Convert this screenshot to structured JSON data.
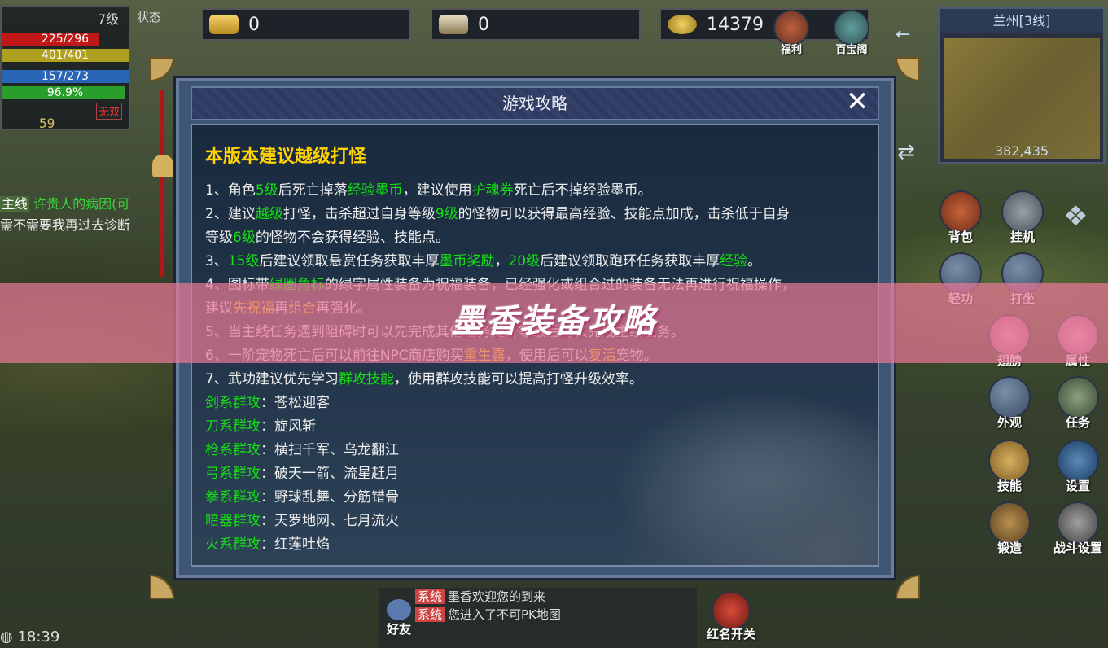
{
  "player": {
    "level": "7级",
    "state": "状态",
    "hp": "225/296",
    "mp": "401/401",
    "exp": "157/273",
    "percent": "96.9%",
    "tag": "无双",
    "value": "59",
    "hp_fraction": 0.76
  },
  "quest": {
    "tag": "主线",
    "title": "许贵人的病因(可",
    "text": "需不需要我再过去诊断"
  },
  "currencies": [
    {
      "name": "gold-ingot",
      "value": "0"
    },
    {
      "name": "locked-ingot",
      "value": "0"
    },
    {
      "name": "coins",
      "value": "14379"
    }
  ],
  "top_buttons": [
    "福利",
    "百宝阁"
  ],
  "minimap": {
    "title": "兰州[3线]",
    "coord": "382,435"
  },
  "side_buttons": [
    "背包",
    "挂机",
    "轻功",
    "打坐",
    "翅膀",
    "属性",
    "外观",
    "任务",
    "技能",
    "设置",
    "锻造",
    "战斗设置"
  ],
  "dialog": {
    "title": "游戏攻略",
    "heading": "本版本建议越级打怪",
    "lines": [
      [
        {
          "t": "1、角色"
        },
        {
          "t": "5级",
          "c": "g"
        },
        {
          "t": "后死亡掉落"
        },
        {
          "t": "经验墨币",
          "c": "g"
        },
        {
          "t": "，建议使用"
        },
        {
          "t": "护魂券",
          "c": "g"
        },
        {
          "t": "死亡后不掉经验墨币。"
        }
      ],
      [
        {
          "t": "2、建议"
        },
        {
          "t": "越级",
          "c": "g"
        },
        {
          "t": "打怪，击杀超过自身等级"
        },
        {
          "t": "9级",
          "c": "g"
        },
        {
          "t": "的怪物可以获得最高经验、技能点加成，击杀低于自身"
        }
      ],
      [
        {
          "t": "等级"
        },
        {
          "t": "6级",
          "c": "g"
        },
        {
          "t": "的怪物不会获得经验、技能点。"
        }
      ],
      [
        {
          "t": "3、"
        },
        {
          "t": "15级",
          "c": "g"
        },
        {
          "t": "后建议领取悬赏任务获取丰厚"
        },
        {
          "t": "墨币奖励",
          "c": "g"
        },
        {
          "t": "，"
        },
        {
          "t": "20级",
          "c": "g"
        },
        {
          "t": "后建议领取跑环任务获取丰厚"
        },
        {
          "t": "经验",
          "c": "g"
        },
        {
          "t": "。"
        }
      ],
      [
        {
          "t": "4、图标带"
        },
        {
          "t": "绿圈角标",
          "c": "g"
        },
        {
          "t": "的绿字属性装备为祝福装备，已经强化或组合过的装备无法再进行祝福操作，"
        }
      ],
      [
        {
          "t": "建议"
        },
        {
          "t": "先祝福",
          "c": "y"
        },
        {
          "t": "再"
        },
        {
          "t": "组合",
          "c": "y"
        },
        {
          "t": "再强化。"
        }
      ],
      [
        {
          "t": "5、当主线任务遇到阻碍时可以先完成其他任务提升等级后再去完成主线任务。"
        }
      ],
      [
        {
          "t": "6、一阶宠物死亡后可以前往NPC商店购买"
        },
        {
          "t": "重生露",
          "c": "y"
        },
        {
          "t": "，使用后可以"
        },
        {
          "t": "复活",
          "c": "y"
        },
        {
          "t": "宠物。"
        }
      ],
      [
        {
          "t": "7、武功建议优先学习"
        },
        {
          "t": "群攻技能",
          "c": "g"
        },
        {
          "t": "，使用群攻技能可以提高打怪升级效率。"
        }
      ],
      [
        {
          "t": "剑系群攻",
          "c": "g"
        },
        {
          "t": "：苍松迎客"
        }
      ],
      [
        {
          "t": "刀系群攻",
          "c": "g"
        },
        {
          "t": "：旋风斩"
        }
      ],
      [
        {
          "t": "枪系群攻",
          "c": "g"
        },
        {
          "t": "：横扫千军、乌龙翻江"
        }
      ],
      [
        {
          "t": "弓系群攻",
          "c": "g"
        },
        {
          "t": "：破天一箭、流星赶月"
        }
      ],
      [
        {
          "t": "拳系群攻",
          "c": "g"
        },
        {
          "t": "：野球乱舞、分筋错骨"
        }
      ],
      [
        {
          "t": "暗器群攻",
          "c": "g"
        },
        {
          "t": "：天罗地网、七月流火"
        }
      ],
      [
        {
          "t": "火系群攻",
          "c": "g"
        },
        {
          "t": "：红莲吐焰"
        }
      ]
    ]
  },
  "banner": "墨香装备攻略",
  "chat": {
    "friends": "好友",
    "lines": [
      {
        "tag": "系统",
        "text": "墨香欢迎您的到来"
      },
      {
        "tag": "系统",
        "text": "您进入了不可PK地图"
      }
    ]
  },
  "redname": "红名开关",
  "time": "18:39",
  "colors": {
    "green": "#14e014",
    "yellow": "#ffd200",
    "banner": "#e87896"
  }
}
